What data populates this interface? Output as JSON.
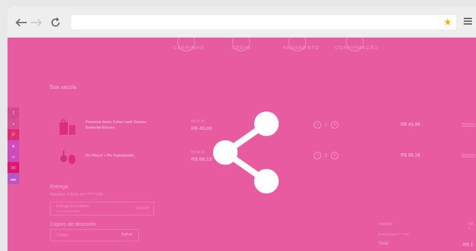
{
  "browser": {
    "url": "",
    "icons": [
      "back-arrow-icon",
      "forward-arrow-icon",
      "reload-icon",
      "star-icon",
      "hamburger-menu-icon"
    ],
    "star_color": "#f5b800"
  },
  "checkout": {
    "steps": [
      "CARRINHO",
      "LOGIN",
      "PAGAMENTO",
      "CONFIRMAÇÃO"
    ],
    "bag_title": "Sua sacola",
    "items": [
      {
        "name": "Presente Avon Color Lash Genius Especial Escuro",
        "old_price": "R$ 63,90",
        "price": "R$ 45,99",
        "qty": "1",
        "total": "R$ 45,99",
        "remove": "Remover"
      },
      {
        "name": "Kit Pincel + Pó Translúcido",
        "old_price": "R$ 99,90",
        "price": "R$ 68,18",
        "qty": "1",
        "total": "R$ 68,18",
        "remove": "Remover"
      }
    ],
    "delivery": {
      "title": "Entrega",
      "receive_text": "Receber 2 itens em *****-180",
      "option_name": "Entrega Econômica",
      "option_detail": "Em até 8 dias úteis",
      "option_price": "R$ 9,88"
    },
    "coupon": {
      "title": "Cupom de desconto",
      "placeholder": "Código",
      "apply_label": "Aplicar"
    },
    "summary": {
      "subtotal_label": "Subtotal",
      "subtotal_value": "R$ 1",
      "shipping_label": "Entrega para *****-180",
      "total_label": "Total",
      "total_value": "R$ 1"
    }
  },
  "overlay": {
    "color": "#e95ba0",
    "icon": "share-icon"
  }
}
